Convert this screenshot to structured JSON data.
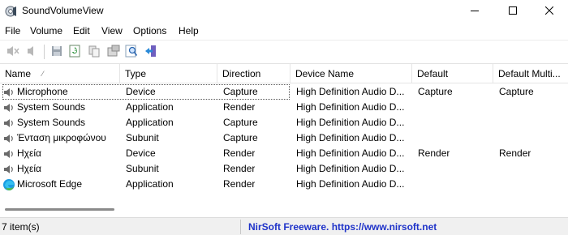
{
  "window": {
    "title": "SoundVolumeView",
    "icon": "speaker-gear-icon",
    "buttons": {
      "minimize": "minimize-icon",
      "maximize": "maximize-icon",
      "close": "close-icon"
    }
  },
  "menu": {
    "items": [
      "File",
      "Volume",
      "Edit",
      "View",
      "Options",
      "Help"
    ]
  },
  "toolbar": {
    "icons": [
      "mute-icon",
      "unmute-icon",
      "save-icon",
      "refresh-icon",
      "copy-icon",
      "properties-icon",
      "find-icon",
      "exit-icon"
    ]
  },
  "table": {
    "columns": [
      "Name",
      "Type",
      "Direction",
      "Device Name",
      "Default",
      "Default Multi..."
    ],
    "sort_indicator": "⁄",
    "rows": [
      {
        "icon": "speaker-icon",
        "name": "Microphone",
        "type": "Device",
        "direction": "Capture",
        "device": "High Definition Audio D...",
        "default": "Capture",
        "default_multi": "Capture",
        "selected": true
      },
      {
        "icon": "speaker-icon",
        "name": "System Sounds",
        "type": "Application",
        "direction": "Render",
        "device": "High Definition Audio D...",
        "default": "",
        "default_multi": ""
      },
      {
        "icon": "speaker-icon",
        "name": "System Sounds",
        "type": "Application",
        "direction": "Capture",
        "device": "High Definition Audio D...",
        "default": "",
        "default_multi": ""
      },
      {
        "icon": "speaker-icon",
        "name": "Ένταση μικροφώνου",
        "type": "Subunit",
        "direction": "Capture",
        "device": "High Definition Audio D...",
        "default": "",
        "default_multi": ""
      },
      {
        "icon": "speaker-icon",
        "name": "Ηχεία",
        "type": "Device",
        "direction": "Render",
        "device": "High Definition Audio D...",
        "default": "Render",
        "default_multi": "Render"
      },
      {
        "icon": "speaker-icon",
        "name": "Ηχεία",
        "type": "Subunit",
        "direction": "Render",
        "device": "High Definition Audio D...",
        "default": "",
        "default_multi": ""
      },
      {
        "icon": "edge-icon",
        "name": "Microsoft Edge",
        "type": "Application",
        "direction": "Render",
        "device": "High Definition Audio D...",
        "default": "",
        "default_multi": ""
      }
    ]
  },
  "status": {
    "count": "7 item(s)",
    "credit": "NirSoft Freeware. https://www.nirsoft.net",
    "credit_color": "#1f33c9"
  }
}
